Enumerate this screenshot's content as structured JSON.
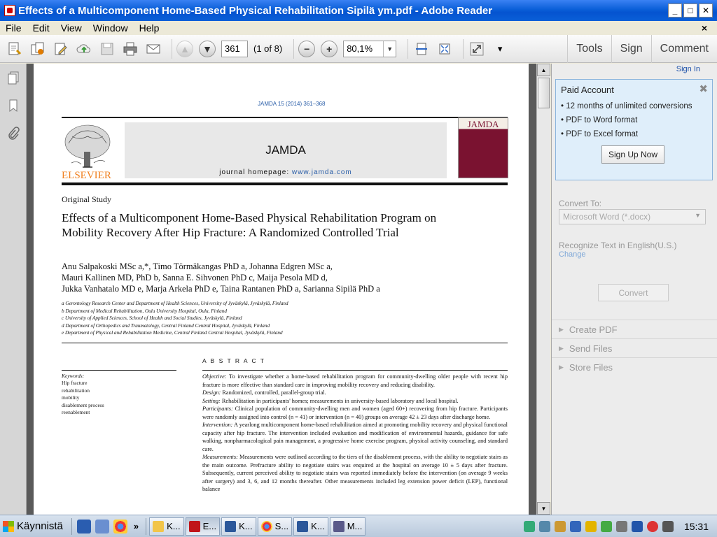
{
  "window": {
    "title": "Effects of a Multicomponent Home-Based Physical Rehabilitation Sipilä ym.pdf - Adobe Reader",
    "min_label": "_",
    "max_label": "□",
    "close_label": "✕"
  },
  "menu": {
    "items": [
      "File",
      "Edit",
      "View",
      "Window",
      "Help"
    ],
    "doc_close": "×"
  },
  "toolbar": {
    "page_number": "361",
    "page_of": "(1 of 8)",
    "zoom": "80,1%",
    "up_label": "▲",
    "down_label": "▼",
    "zoom_out_label": "−",
    "zoom_in_label": "+",
    "more_label": "▾",
    "tools": "Tools",
    "sign": "Sign",
    "comment": "Comment"
  },
  "document": {
    "journal_ref": "JAMDA 15 (2014) 361–368",
    "publisher": "ELSEVIER",
    "journal_name": "JAMDA",
    "homepage_label": "journal homepage: ",
    "homepage_url": "www.jamda.com",
    "cover_title": "JAMDA",
    "article_type": "Original Study",
    "title": "Effects of a Multicomponent Home-Based Physical Rehabilitation Program on Mobility Recovery After Hip Fracture: A Randomized Controlled Trial",
    "authors": [
      "Anu Salpakoski MSc a,*, Timo Törmäkangas PhD a, Johanna Edgren MSc a,",
      "Mauri Kallinen MD, PhD b, Sanna E. Sihvonen PhD c, Maija Pesola MD d,",
      "Jukka Vanhatalo MD e, Marja Arkela PhD e, Taina Rantanen PhD a, Sarianna Sipilä PhD a"
    ],
    "affiliations": [
      "a Gerontology Research Center and Department of Health Sciences, University of Jyväskylä, Jyväskylä, Finland",
      "b Department of Medical Rehabilitation, Oulu University Hospital, Oulu, Finland",
      "c University of Applied Sciences, School of Health and Social Studies, Jyväskylä, Finland",
      "d Department of Orthopedics and Traumatology, Central Finland Central Hospital, Jyväskylä, Finland",
      "e Department of Physical and Rehabilitation Medicine, Central Finland Central Hospital, Jyväskylä, Finland"
    ],
    "keywords_label": "Keywords:",
    "keywords": [
      "Hip fracture",
      "rehabilitation",
      "mobility",
      "disablement process",
      "reenablement"
    ],
    "abstract_heading": "A B S T R A C T",
    "abstract": [
      {
        "label": "Objective:",
        "text": " To investigate whether a home-based rehabilitation program for community-dwelling older people with recent hip fracture is more effective than standard care in improving mobility recovery and reducing disability."
      },
      {
        "label": "Design:",
        "text": " Randomized, controlled, parallel-group trial."
      },
      {
        "label": "Setting:",
        "text": " Rehabilitation in participants' homes; measurements in university-based laboratory and local hospital."
      },
      {
        "label": "Participants:",
        "text": " Clinical population of community-dwelling men and women (aged 60+) recovering from hip fracture. Participants were randomly assigned into control (n = 41) or intervention (n = 40) groups on average 42 ± 23 days after discharge home."
      },
      {
        "label": "Intervention:",
        "text": " A yearlong multicomponent home-based rehabilitation aimed at promoting mobility recovery and physical functional capacity after hip fracture. The intervention included evaluation and modification of environmental hazards, guidance for safe walking, nonpharmacological pain management, a progressive home exercise program, physical activity counseling, and standard care."
      },
      {
        "label": "Measurements:",
        "text": " Measurements were outlined according to the tiers of the disablement process, with the ability to negotiate stairs as the main outcome. Prefracture ability to negotiate stairs was enquired at the hospital on average 10 ± 5 days after fracture. Subsequently, current perceived ability to negotiate stairs was reported immediately before the intervention (on average 9 weeks after surgery) and 3, 6, and 12 months thereafter. Other measurements included leg extension power deficit (LEP), functional balance"
      }
    ]
  },
  "right_panel": {
    "sign_in": "Sign In",
    "paid_title": "Paid Account",
    "paid_close": "✖",
    "paid_items": [
      "12 months of unlimited conversions",
      "PDF to Word format",
      "PDF to Excel format"
    ],
    "signup_button": "Sign Up Now",
    "convert_to_label": "Convert To:",
    "convert_format": "Microsoft Word (*.docx)",
    "recognize": "Recognize Text in English(U.S.)",
    "change": "Change",
    "convert_button": "Convert",
    "sections": [
      "Create PDF",
      "Send Files",
      "Store Files"
    ]
  },
  "taskbar": {
    "start": "Käynnistä",
    "more": "»",
    "buttons": [
      "K...",
      "E...",
      "K...",
      "S...",
      "K...",
      "M..."
    ],
    "clock": "15:31"
  },
  "colors": {
    "titlebar": "#0a5fd8",
    "link": "#1a4fa8",
    "paid_bg": "#dfeefa"
  }
}
